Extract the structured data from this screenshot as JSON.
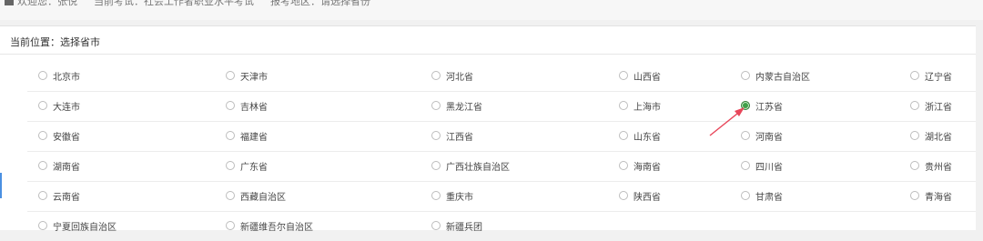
{
  "topbar": {
    "welcome": "欢迎您：张悦",
    "exam": "当前考试：社会工作者职业水平考试",
    "region": "报考地区：请选择省份"
  },
  "breadcrumb": "当前位置：选择省市",
  "provinces": [
    [
      "北京市",
      "天津市",
      "河北省",
      "山西省",
      "内蒙古自治区",
      "辽宁省"
    ],
    [
      "大连市",
      "吉林省",
      "黑龙江省",
      "上海市",
      "江苏省",
      "浙江省"
    ],
    [
      "安徽省",
      "福建省",
      "江西省",
      "山东省",
      "河南省",
      "湖北省"
    ],
    [
      "湖南省",
      "广东省",
      "广西壮族自治区",
      "海南省",
      "四川省",
      "贵州省"
    ],
    [
      "云南省",
      "西藏自治区",
      "重庆市",
      "陕西省",
      "甘肃省",
      "青海省"
    ],
    [
      "宁夏回族自治区",
      "新疆维吾尔自治区",
      "新疆兵团"
    ]
  ],
  "selected": "江苏省",
  "colors": {
    "selected_radio": "#3fa048",
    "arrow": "#e8465a",
    "accent": "#4a90e2"
  }
}
